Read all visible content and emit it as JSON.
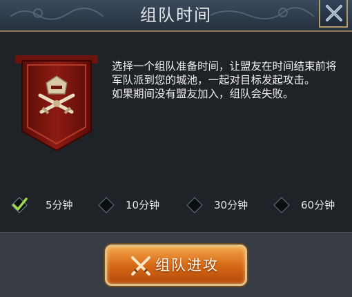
{
  "header": {
    "title": "组队时间",
    "close_icon": "close-x-icon"
  },
  "description": "选择一个组队准备时间，让盟友在时间结束前将军队派到您的城池，一起对目标发起攻击。\n如果期间没有盟友加入，组队会失败。",
  "banner": {
    "icon": "crossed-swords-helmet-icon"
  },
  "options": [
    {
      "label": "5分钟",
      "selected": true
    },
    {
      "label": "10分钟",
      "selected": false
    },
    {
      "label": "30分钟",
      "selected": false
    },
    {
      "label": "60分钟",
      "selected": false
    }
  ],
  "action_button": {
    "label": "组队进攻",
    "icon": "crossed-swords-icon"
  },
  "colors": {
    "accent_gold": "#b29a66",
    "check_green": "#9ed94a",
    "button_orange": "#d76a17"
  }
}
